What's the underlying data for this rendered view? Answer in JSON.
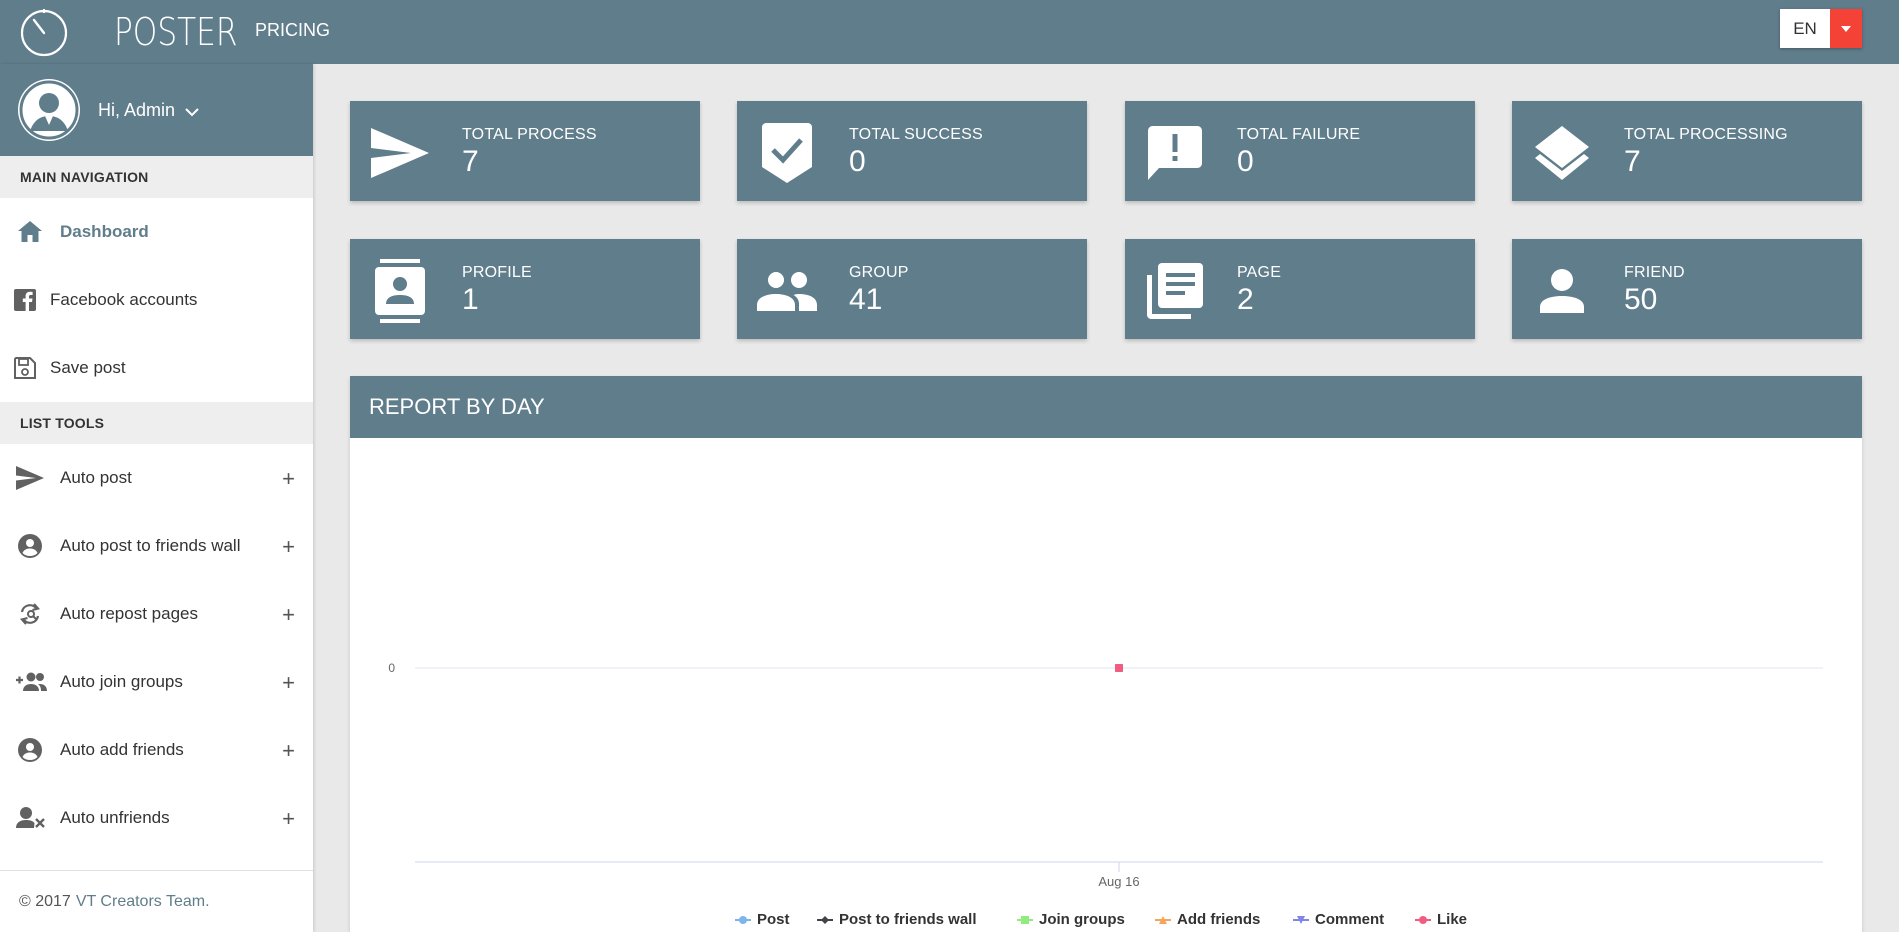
{
  "header": {
    "brand": "POSTER",
    "nav_pricing": "PRICING",
    "language": "EN"
  },
  "sidebar": {
    "user_greeting": "Hi, Admin",
    "sections": {
      "main_navigation": "MAIN NAVIGATION",
      "list_tools": "LIST TOOLS"
    },
    "main_items": [
      {
        "label": "Dashboard",
        "icon": "home-icon",
        "active": true
      },
      {
        "label": "Facebook accounts",
        "icon": "facebook-icon"
      },
      {
        "label": "Save post",
        "icon": "save-icon"
      }
    ],
    "tool_items": [
      {
        "label": "Auto post",
        "icon": "send-icon"
      },
      {
        "label": "Auto post to friends wall",
        "icon": "account-circle-icon"
      },
      {
        "label": "Auto repost pages",
        "icon": "repost-icon"
      },
      {
        "label": "Auto join groups",
        "icon": "group-add-icon"
      },
      {
        "label": "Auto add friends",
        "icon": "account-circle-icon"
      },
      {
        "label": "Auto unfriends",
        "icon": "person-remove-icon"
      }
    ],
    "expand_symbol": "+",
    "footer": {
      "copyright": "© 2017",
      "team": "VT Creators Team."
    }
  },
  "stats": [
    {
      "label": "TOTAL PROCESS",
      "value": "7",
      "icon": "send-icon"
    },
    {
      "label": "TOTAL SUCCESS",
      "value": "0",
      "icon": "verified-check-icon"
    },
    {
      "label": "TOTAL FAILURE",
      "value": "0",
      "icon": "feedback-alert-icon"
    },
    {
      "label": "TOTAL PROCESSING",
      "value": "7",
      "icon": "layers-icon"
    },
    {
      "label": "PROFILE",
      "value": "1",
      "icon": "contact-card-icon"
    },
    {
      "label": "GROUP",
      "value": "41",
      "icon": "group-icon"
    },
    {
      "label": "PAGE",
      "value": "2",
      "icon": "library-books-icon"
    },
    {
      "label": "FRIEND",
      "value": "50",
      "icon": "person-icon"
    }
  ],
  "report": {
    "title": "REPORT BY DAY"
  },
  "chart_data": {
    "type": "line",
    "x": [
      "Aug 16"
    ],
    "y_ticks": [
      "0"
    ],
    "series": [
      {
        "name": "Post",
        "values": [
          0
        ],
        "color": "#7cb5ec",
        "marker": "circle"
      },
      {
        "name": "Post to friends wall",
        "values": [
          0
        ],
        "color": "#434348",
        "marker": "diamond"
      },
      {
        "name": "Join groups",
        "values": [
          0
        ],
        "color": "#90ed7d",
        "marker": "square"
      },
      {
        "name": "Add friends",
        "values": [
          0
        ],
        "color": "#f7a35c",
        "marker": "triangle"
      },
      {
        "name": "Comment",
        "values": [
          0
        ],
        "color": "#8085e9",
        "marker": "triangle-down"
      },
      {
        "name": "Like",
        "values": [
          0
        ],
        "color": "#f15c80",
        "marker": "circle"
      }
    ],
    "legend_position": "bottom",
    "colors": {
      "last_point_marker": "#f15c80"
    }
  },
  "colors": {
    "primary": "#607d8b",
    "accent": "#f44336"
  }
}
